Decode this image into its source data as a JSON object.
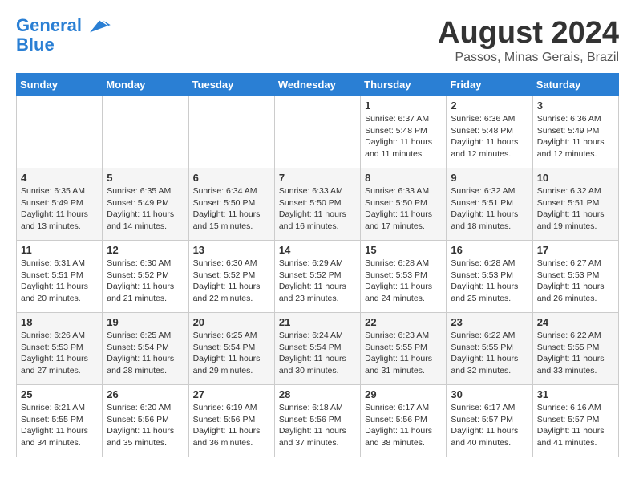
{
  "header": {
    "logo_line1": "General",
    "logo_line2": "Blue",
    "title": "August 2024",
    "subtitle": "Passos, Minas Gerais, Brazil"
  },
  "weekdays": [
    "Sunday",
    "Monday",
    "Tuesday",
    "Wednesday",
    "Thursday",
    "Friday",
    "Saturday"
  ],
  "weeks": [
    [
      {
        "day": "",
        "info": ""
      },
      {
        "day": "",
        "info": ""
      },
      {
        "day": "",
        "info": ""
      },
      {
        "day": "",
        "info": ""
      },
      {
        "day": "1",
        "info": "Sunrise: 6:37 AM\nSunset: 5:48 PM\nDaylight: 11 hours and 11 minutes."
      },
      {
        "day": "2",
        "info": "Sunrise: 6:36 AM\nSunset: 5:48 PM\nDaylight: 11 hours and 12 minutes."
      },
      {
        "day": "3",
        "info": "Sunrise: 6:36 AM\nSunset: 5:49 PM\nDaylight: 11 hours and 12 minutes."
      }
    ],
    [
      {
        "day": "4",
        "info": "Sunrise: 6:35 AM\nSunset: 5:49 PM\nDaylight: 11 hours and 13 minutes."
      },
      {
        "day": "5",
        "info": "Sunrise: 6:35 AM\nSunset: 5:49 PM\nDaylight: 11 hours and 14 minutes."
      },
      {
        "day": "6",
        "info": "Sunrise: 6:34 AM\nSunset: 5:50 PM\nDaylight: 11 hours and 15 minutes."
      },
      {
        "day": "7",
        "info": "Sunrise: 6:33 AM\nSunset: 5:50 PM\nDaylight: 11 hours and 16 minutes."
      },
      {
        "day": "8",
        "info": "Sunrise: 6:33 AM\nSunset: 5:50 PM\nDaylight: 11 hours and 17 minutes."
      },
      {
        "day": "9",
        "info": "Sunrise: 6:32 AM\nSunset: 5:51 PM\nDaylight: 11 hours and 18 minutes."
      },
      {
        "day": "10",
        "info": "Sunrise: 6:32 AM\nSunset: 5:51 PM\nDaylight: 11 hours and 19 minutes."
      }
    ],
    [
      {
        "day": "11",
        "info": "Sunrise: 6:31 AM\nSunset: 5:51 PM\nDaylight: 11 hours and 20 minutes."
      },
      {
        "day": "12",
        "info": "Sunrise: 6:30 AM\nSunset: 5:52 PM\nDaylight: 11 hours and 21 minutes."
      },
      {
        "day": "13",
        "info": "Sunrise: 6:30 AM\nSunset: 5:52 PM\nDaylight: 11 hours and 22 minutes."
      },
      {
        "day": "14",
        "info": "Sunrise: 6:29 AM\nSunset: 5:52 PM\nDaylight: 11 hours and 23 minutes."
      },
      {
        "day": "15",
        "info": "Sunrise: 6:28 AM\nSunset: 5:53 PM\nDaylight: 11 hours and 24 minutes."
      },
      {
        "day": "16",
        "info": "Sunrise: 6:28 AM\nSunset: 5:53 PM\nDaylight: 11 hours and 25 minutes."
      },
      {
        "day": "17",
        "info": "Sunrise: 6:27 AM\nSunset: 5:53 PM\nDaylight: 11 hours and 26 minutes."
      }
    ],
    [
      {
        "day": "18",
        "info": "Sunrise: 6:26 AM\nSunset: 5:53 PM\nDaylight: 11 hours and 27 minutes."
      },
      {
        "day": "19",
        "info": "Sunrise: 6:25 AM\nSunset: 5:54 PM\nDaylight: 11 hours and 28 minutes."
      },
      {
        "day": "20",
        "info": "Sunrise: 6:25 AM\nSunset: 5:54 PM\nDaylight: 11 hours and 29 minutes."
      },
      {
        "day": "21",
        "info": "Sunrise: 6:24 AM\nSunset: 5:54 PM\nDaylight: 11 hours and 30 minutes."
      },
      {
        "day": "22",
        "info": "Sunrise: 6:23 AM\nSunset: 5:55 PM\nDaylight: 11 hours and 31 minutes."
      },
      {
        "day": "23",
        "info": "Sunrise: 6:22 AM\nSunset: 5:55 PM\nDaylight: 11 hours and 32 minutes."
      },
      {
        "day": "24",
        "info": "Sunrise: 6:22 AM\nSunset: 5:55 PM\nDaylight: 11 hours and 33 minutes."
      }
    ],
    [
      {
        "day": "25",
        "info": "Sunrise: 6:21 AM\nSunset: 5:55 PM\nDaylight: 11 hours and 34 minutes."
      },
      {
        "day": "26",
        "info": "Sunrise: 6:20 AM\nSunset: 5:56 PM\nDaylight: 11 hours and 35 minutes."
      },
      {
        "day": "27",
        "info": "Sunrise: 6:19 AM\nSunset: 5:56 PM\nDaylight: 11 hours and 36 minutes."
      },
      {
        "day": "28",
        "info": "Sunrise: 6:18 AM\nSunset: 5:56 PM\nDaylight: 11 hours and 37 minutes."
      },
      {
        "day": "29",
        "info": "Sunrise: 6:17 AM\nSunset: 5:56 PM\nDaylight: 11 hours and 38 minutes."
      },
      {
        "day": "30",
        "info": "Sunrise: 6:17 AM\nSunset: 5:57 PM\nDaylight: 11 hours and 40 minutes."
      },
      {
        "day": "31",
        "info": "Sunrise: 6:16 AM\nSunset: 5:57 PM\nDaylight: 11 hours and 41 minutes."
      }
    ]
  ]
}
